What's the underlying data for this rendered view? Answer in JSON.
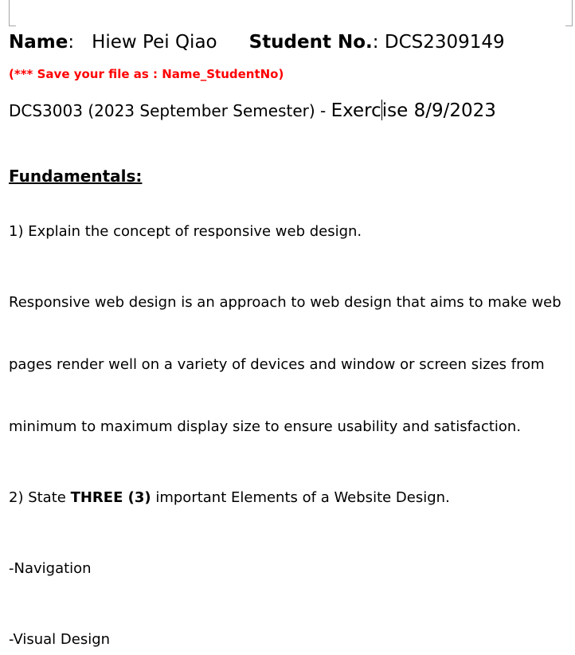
{
  "header": {
    "name_label": "Name",
    "name_colon": ":",
    "name_value": "Hiew Pei Qiao",
    "student_no_label": "Student No.",
    "student_no_colon": ":",
    "student_no_value": "DCS2309149"
  },
  "save_note": "(*** Save your file as : Name_StudentNo)",
  "course_line": {
    "course": "DCS3003 (2023 September Semester) - ",
    "exercise_before_cursor": "Exerc",
    "exercise_after_cursor": "ise 8/9/2023"
  },
  "section_title": "Fundamentals:",
  "question1": "1) Explain the concept of responsive web design.",
  "answer1_lines": [
    "Responsive web design is an approach to web design that aims to make web",
    "pages render well on a variety of devices and window or screen sizes from",
    "minimum to maximum display size to ensure usability and satisfaction."
  ],
  "question2": {
    "prefix": "2) State ",
    "bold": "THREE (3)",
    "suffix": " important Elements of a Website Design."
  },
  "elements": [
    "-Navigation",
    "-Visual Design"
  ],
  "colors": {
    "note_red": "#ff0000",
    "crop_mark_gray": "#a6a6a6"
  }
}
